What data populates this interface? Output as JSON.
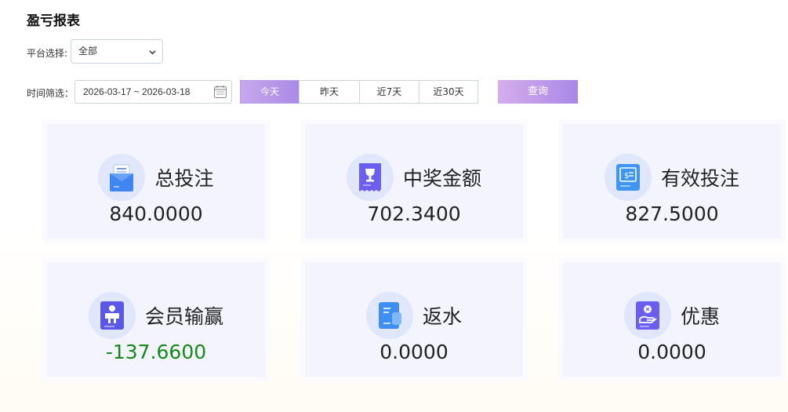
{
  "page_title": "盈亏报表",
  "filters": {
    "platform_label": "平台选择:",
    "platform_value": "全部",
    "time_label": "时间筛选：",
    "date_range": "2026-03-17 ~ 2026-03-18",
    "quick_tabs": [
      "今天",
      "昨天",
      "近7天",
      "近30天"
    ],
    "active_tab": "今天",
    "query_label": "查询"
  },
  "cards": [
    {
      "title": "总投注",
      "value": "840.0000",
      "icon": "document-folder-icon"
    },
    {
      "title": "中奖金额",
      "value": "702.3400",
      "icon": "trophy-ticket-icon"
    },
    {
      "title": "有效投注",
      "value": "827.5000",
      "icon": "cash-register-icon"
    },
    {
      "title": "会员输赢",
      "value": "-137.6600",
      "icon": "member-icon"
    },
    {
      "title": "返水",
      "value": "0.0000",
      "icon": "receipt-icon"
    },
    {
      "title": "优惠",
      "value": "0.0000",
      "icon": "coin-hand-icon"
    }
  ],
  "colors": {
    "accent": "#a98ae6",
    "negative": "#148a14",
    "card_bg": "#f3f4ff"
  }
}
